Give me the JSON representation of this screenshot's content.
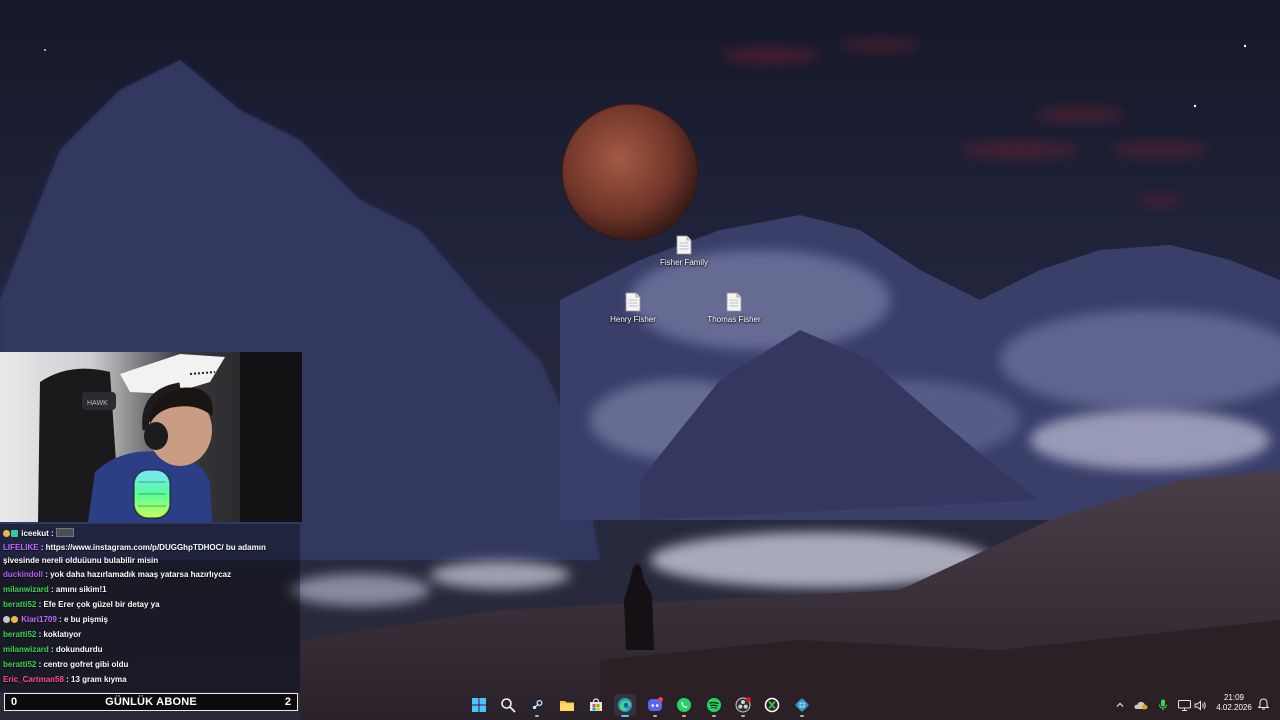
{
  "desktop": {
    "icons": [
      {
        "label": "Fisher Family",
        "icon": "text-document-icon"
      },
      {
        "label": "Henry Fisher",
        "icon": "text-document-icon"
      },
      {
        "label": "Thomas Fisher",
        "icon": "text-document-icon"
      }
    ]
  },
  "chat": {
    "messages": [
      {
        "user": "iceekut",
        "text": "",
        "user_color": "#ffffff",
        "badges": [
          "#e8b84a",
          "#36c7a0"
        ],
        "emote": "emote-image"
      },
      {
        "user": "LIFELIKE",
        "text": "https://www.instagram.com/p/DUGGhpTDHOC/ bu adamın şivesinde nereli olduüunu bulabilir misin",
        "user_color": "#c06cff",
        "badges": []
      },
      {
        "user": "duckindoll",
        "text": "yok daha hazırlamadık maaş yatarsa hazırlıycaz",
        "user_color": "#b35cff",
        "badges": []
      },
      {
        "user": "milanwizard",
        "text": "amını sikim!1",
        "user_color": "#39d353",
        "badges": []
      },
      {
        "user": "beratti52",
        "text": "Efe Erer çok güzel bir detay ya",
        "user_color": "#39d353",
        "badges": []
      },
      {
        "user": "Kiari1709",
        "text": "e bu pişmiş",
        "user_color": "#c06cff",
        "badges": [
          "#c9c9c9",
          "#e8b84a"
        ]
      },
      {
        "user": "beratti52",
        "text": "koklatıyor",
        "user_color": "#39d353",
        "badges": []
      },
      {
        "user": "milanwizard",
        "text": "dokundurdu",
        "user_color": "#39d353",
        "badges": []
      },
      {
        "user": "beratti52",
        "text": "centro gofret gibi oldu",
        "user_color": "#39d353",
        "badges": []
      },
      {
        "user": "Eric_Cartman58",
        "text": "13 gram kıyma",
        "user_color": "#ff4d8d",
        "badges": []
      }
    ],
    "separator": " : "
  },
  "subscriber_bar": {
    "current": "0",
    "title": "GÜNLÜK ABONE",
    "goal": "2"
  },
  "taskbar": {
    "apps": [
      {
        "name": "start-icon"
      },
      {
        "name": "search-icon"
      },
      {
        "name": "steam-icon"
      },
      {
        "name": "file-explorer-icon"
      },
      {
        "name": "microsoft-store-icon"
      },
      {
        "name": "edge-icon"
      },
      {
        "name": "discord-icon"
      },
      {
        "name": "whatsapp-icon"
      },
      {
        "name": "spotify-icon"
      },
      {
        "name": "obs-icon"
      },
      {
        "name": "xbox-icon"
      },
      {
        "name": "app-icon"
      }
    ],
    "tray": [
      "chevron-up-icon",
      "onedrive-icon",
      "microphone-icon",
      "network-icon",
      "volume-icon"
    ],
    "clock": {
      "time": "21:09",
      "date": "4.02.2026"
    }
  },
  "colors": {
    "desktop_bg": "#1d2134",
    "sub_bar_bg": "#0c0c0c",
    "sub_bar_border": "#e8e8e8"
  }
}
